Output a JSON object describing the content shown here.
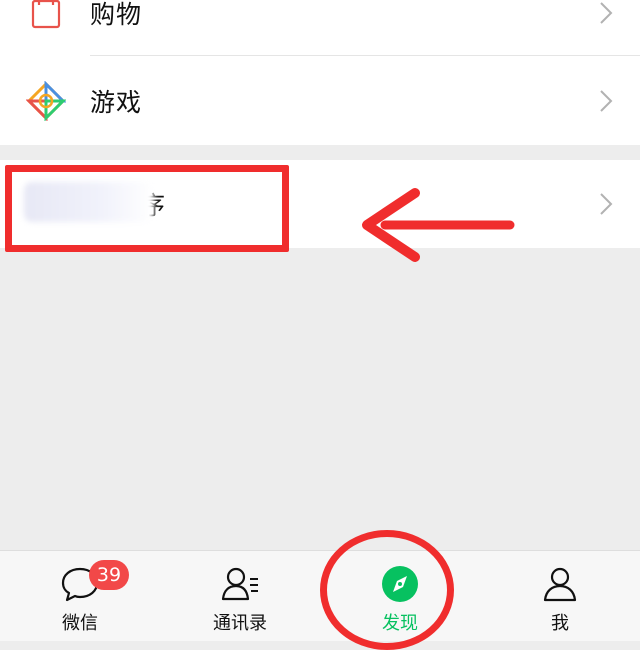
{
  "menu": {
    "items": [
      {
        "label": "购物",
        "icon": "shopping-bag-icon"
      },
      {
        "label": "游戏",
        "icon": "game-diamond-icon"
      },
      {
        "label": "序",
        "icon": "mini-program-icon"
      }
    ]
  },
  "tabbar": {
    "tabs": [
      {
        "label": "微信",
        "icon": "chat-bubble-icon",
        "badge": "39"
      },
      {
        "label": "通讯录",
        "icon": "contacts-icon"
      },
      {
        "label": "发现",
        "icon": "compass-icon",
        "active": true
      },
      {
        "label": "我",
        "icon": "person-icon"
      }
    ]
  },
  "colors": {
    "accent_green": "#07c160",
    "badge_red": "#f24848",
    "annotation_red": "#f02d2d",
    "background": "#ededed"
  }
}
